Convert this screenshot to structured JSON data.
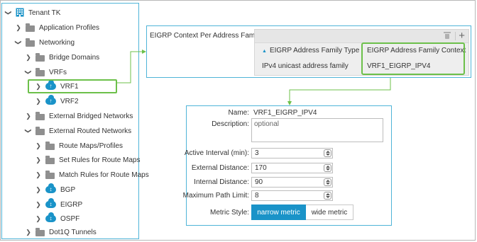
{
  "tree": {
    "items": [
      {
        "label": "Tenant TK",
        "icon": "building-icon",
        "expanded": true
      },
      {
        "label": "Application Profiles",
        "icon": "folder-icon",
        "expanded": false
      },
      {
        "label": "Networking",
        "icon": "folder-icon",
        "expanded": true
      },
      {
        "label": "Bridge Domains",
        "icon": "folder-icon",
        "expanded": false
      },
      {
        "label": "VRFs",
        "icon": "folder-icon",
        "expanded": true
      },
      {
        "label": "VRF1",
        "icon": "vrf-cloud-icon",
        "expanded": false,
        "highlighted": true
      },
      {
        "label": "VRF2",
        "icon": "vrf-cloud-icon",
        "expanded": false
      },
      {
        "label": "External Bridged Networks",
        "icon": "folder-icon",
        "expanded": false
      },
      {
        "label": "External Routed Networks",
        "icon": "folder-icon",
        "expanded": true
      },
      {
        "label": "Route Maps/Profiles",
        "icon": "folder-icon",
        "expanded": false
      },
      {
        "label": "Set Rules for Route Maps",
        "icon": "folder-icon",
        "expanded": false
      },
      {
        "label": "Match Rules for Route Maps",
        "icon": "folder-icon",
        "expanded": false
      },
      {
        "label": "BGP",
        "icon": "protocol-cloud-icon",
        "expanded": false
      },
      {
        "label": "EIGRP",
        "icon": "protocol-cloud-icon",
        "expanded": false
      },
      {
        "label": "OSPF",
        "icon": "protocol-cloud-icon",
        "expanded": false
      },
      {
        "label": "Dot1Q Tunnels",
        "icon": "folder-icon",
        "expanded": false
      }
    ]
  },
  "context": {
    "label": "EIGRP Context Per Address Family:",
    "columns": [
      "EIGRP Address Family Type",
      "EIGRP Address Family Context"
    ],
    "rows": [
      [
        "IPv4 unicast address family",
        "VRF1_EIGRP_IPV4"
      ]
    ]
  },
  "props": {
    "name_label": "Name:",
    "name_value": "VRF1_EIGRP_IPV4",
    "description_label": "Description:",
    "description_placeholder": "optional",
    "active_interval_label": "Active Interval (min):",
    "active_interval_value": "3",
    "external_distance_label": "External Distance:",
    "external_distance_value": "170",
    "internal_distance_label": "Internal Distance:",
    "internal_distance_value": "90",
    "max_path_label": "Maximum Path Limit:",
    "max_path_value": "8",
    "metric_style_label": "Metric Style:",
    "metric_options": [
      "narrow metric",
      "wide metric"
    ],
    "metric_selected": "narrow metric"
  },
  "colors": {
    "accent": "#1a93c8",
    "highlight": "#6cc04a",
    "panel_border": "#4fb4d8"
  }
}
